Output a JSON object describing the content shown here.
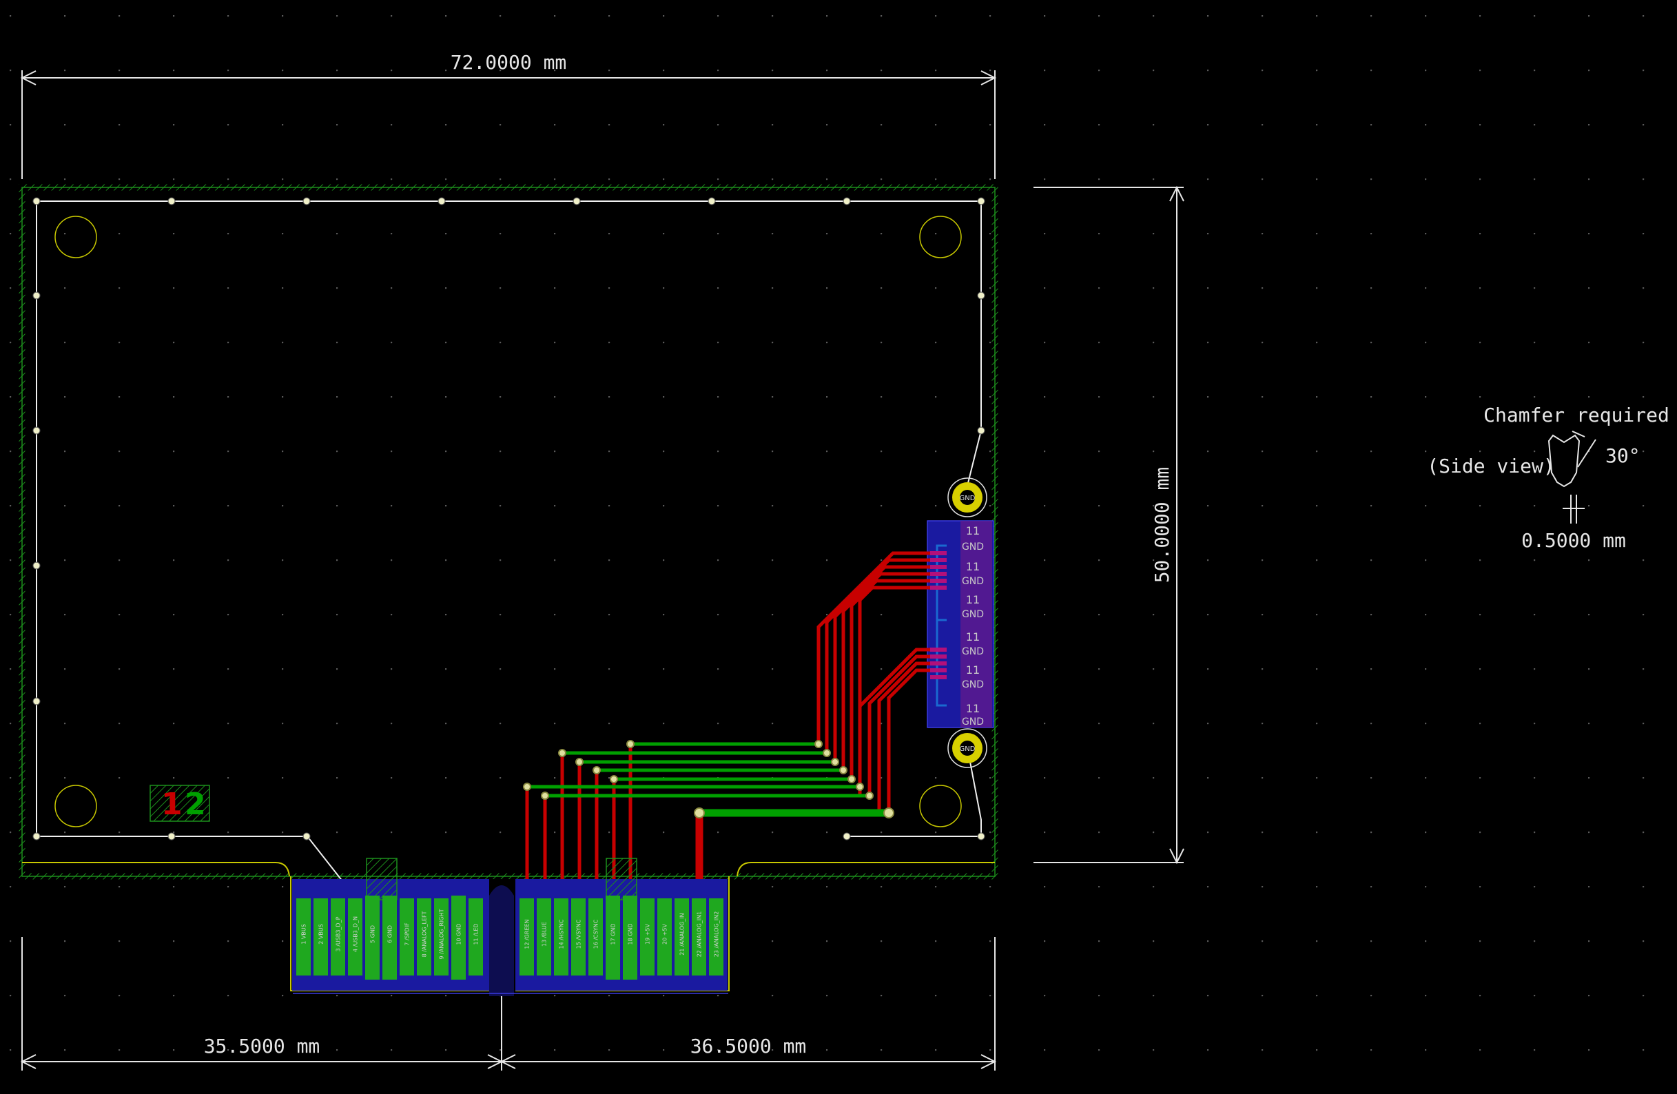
{
  "dimensions": {
    "overall_width": "72.0000 mm",
    "height": "50.0000 mm",
    "left_width": "35.5000 mm",
    "right_width": "36.5000 mm",
    "chamfer_width": "0.5000 mm"
  },
  "chamfer_note": {
    "title": "Chamfer required",
    "side_view": "(Side view)",
    "angle": "30°"
  },
  "layer_markers": {
    "front": "1",
    "back": "2"
  },
  "edge_connector": {
    "left_pins": [
      {
        "num": "1",
        "name": "VBUS"
      },
      {
        "num": "2",
        "name": "VBUS"
      },
      {
        "num": "3",
        "name": "/USB3_D_P"
      },
      {
        "num": "4",
        "name": "/USB3_D_N"
      },
      {
        "num": "5",
        "name": "GND"
      },
      {
        "num": "6",
        "name": "GND"
      },
      {
        "num": "7",
        "name": "/SPDIF"
      },
      {
        "num": "8",
        "name": "/ANALOG_LEFT"
      },
      {
        "num": "9",
        "name": "/ANALOG_RIGHT"
      },
      {
        "num": "10",
        "name": "GND"
      },
      {
        "num": "11",
        "name": "/LED"
      }
    ],
    "right_pins": [
      {
        "num": "12",
        "name": "/GREEN"
      },
      {
        "num": "13",
        "name": "/BLUE"
      },
      {
        "num": "14",
        "name": "/HSYNC"
      },
      {
        "num": "15",
        "name": "/VSYNC"
      },
      {
        "num": "16",
        "name": "/CSYNC"
      },
      {
        "num": "17",
        "name": "GND"
      },
      {
        "num": "18",
        "name": "GND"
      },
      {
        "num": "19",
        "name": "+5V"
      },
      {
        "num": "20",
        "name": "+5V"
      },
      {
        "num": "21",
        "name": "/ANALOG_IN"
      },
      {
        "num": "22",
        "name": "/ANALOG_IN1"
      },
      {
        "num": "23",
        "name": "/ANALOG_IN2"
      }
    ]
  },
  "fpc_connector": {
    "pad_labels": [
      {
        "num": "11",
        "net": "GND"
      },
      {
        "num": "11",
        "net": "GND"
      },
      {
        "num": "11",
        "net": "GND"
      },
      {
        "num": "11",
        "net": "GND"
      },
      {
        "num": "11",
        "net": "GND"
      },
      {
        "num": "11",
        "net": "GND"
      }
    ],
    "mount_hole_label": "GND"
  },
  "colors": {
    "background": "#000000",
    "board_outline": "#d8d000",
    "front_copper": "#c80000",
    "back_copper": "#00a000",
    "zone": "#1a1aa0",
    "silkscreen": "#f0f0f0"
  }
}
